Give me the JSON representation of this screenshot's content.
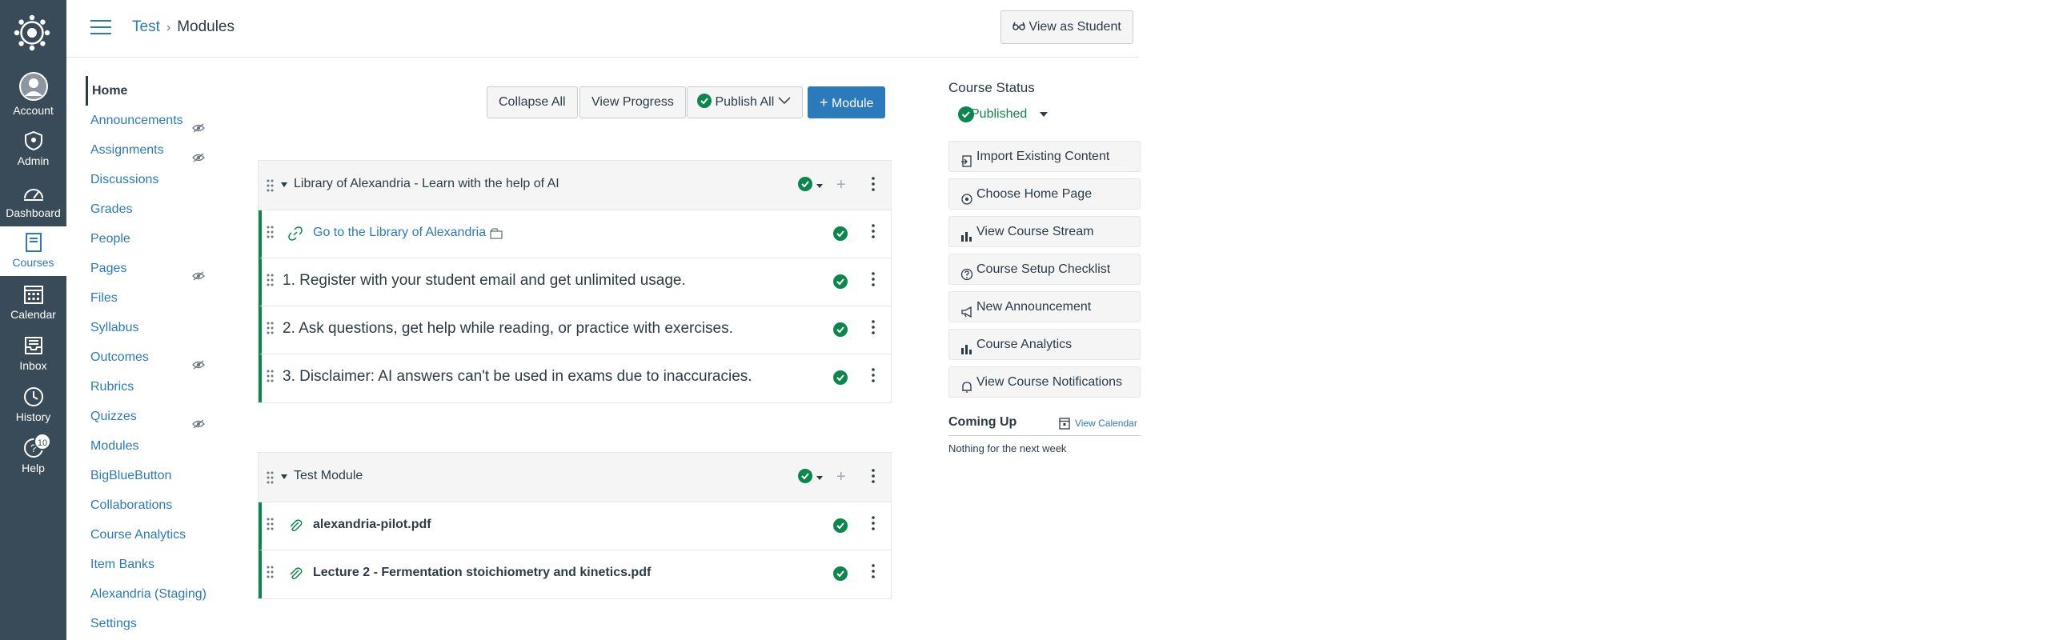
{
  "global_nav": {
    "account": "Account",
    "admin": "Admin",
    "dashboard": "Dashboard",
    "courses": "Courses",
    "calendar": "Calendar",
    "inbox": "Inbox",
    "history": "History",
    "help": "Help",
    "help_badge": "10"
  },
  "header": {
    "breadcrumb_course": "Test",
    "breadcrumb_page": "Modules",
    "view_as_student": "View as Student"
  },
  "course_nav": [
    {
      "label": "Home",
      "hidden": false,
      "active": true
    },
    {
      "label": "Announcements",
      "hidden": true
    },
    {
      "label": "Assignments",
      "hidden": true
    },
    {
      "label": "Discussions",
      "hidden": false
    },
    {
      "label": "Grades",
      "hidden": false
    },
    {
      "label": "People",
      "hidden": false
    },
    {
      "label": "Pages",
      "hidden": true
    },
    {
      "label": "Files",
      "hidden": false
    },
    {
      "label": "Syllabus",
      "hidden": false
    },
    {
      "label": "Outcomes",
      "hidden": true
    },
    {
      "label": "Rubrics",
      "hidden": false
    },
    {
      "label": "Quizzes",
      "hidden": true
    },
    {
      "label": "Modules",
      "hidden": false
    },
    {
      "label": "BigBlueButton",
      "hidden": false
    },
    {
      "label": "Collaborations",
      "hidden": false
    },
    {
      "label": "Course Analytics",
      "hidden": false
    },
    {
      "label": "Item Banks",
      "hidden": false
    },
    {
      "label": "Alexandria (Staging)",
      "hidden": false
    },
    {
      "label": "Settings",
      "hidden": false
    }
  ],
  "toolbar": {
    "collapse_all": "Collapse All",
    "view_progress": "View Progress",
    "publish_all": "Publish All",
    "add_module": "Module"
  },
  "modules": [
    {
      "title": "Library of Alexandria - Learn with the help of AI",
      "items": [
        {
          "type": "external_link",
          "title": "Go to the Library of Alexandria"
        },
        {
          "type": "subheader",
          "title": "1. Register with your student email and get unlimited usage."
        },
        {
          "type": "subheader",
          "title": "2. Ask questions, get help while reading, or practice with exercises."
        },
        {
          "type": "subheader",
          "title": "3. Disclaimer: AI answers can't be used in exams due to inaccuracies."
        }
      ]
    },
    {
      "title": "Test Module",
      "items": [
        {
          "type": "file",
          "title": "alexandria-pilot.pdf"
        },
        {
          "type": "file",
          "title": "Lecture 2 - Fermentation stoichiometry and kinetics.pdf"
        }
      ]
    }
  ],
  "sidebar": {
    "course_status": "Course Status",
    "published": "Published",
    "buttons": [
      "Import Existing Content",
      "Choose Home Page",
      "View Course Stream",
      "Course Setup Checklist",
      "New Announcement",
      "Course Analytics",
      "View Course Notifications"
    ],
    "coming_up": "Coming Up",
    "view_calendar": "View Calendar",
    "nothing": "Nothing for the next week"
  },
  "colors": {
    "nav_bg": "#394b58",
    "link": "#2b7abc",
    "published_green": "#0b874b"
  }
}
